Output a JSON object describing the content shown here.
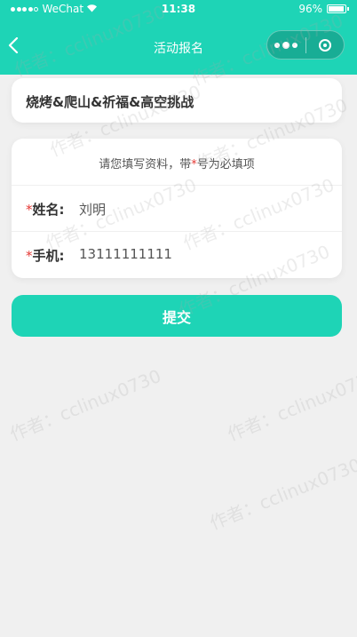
{
  "statusbar": {
    "carrier": "WeChat",
    "time": "11:38",
    "battery": "96%",
    "battery_level": 0.96
  },
  "navbar": {
    "title": "活动报名",
    "back_icon": "chevron-left-icon",
    "more_icon": "more-dots-icon",
    "close_icon": "target-circle-icon"
  },
  "event": {
    "title": "烧烤&爬山&祈福&高空挑战"
  },
  "form": {
    "hint_prefix": "请您填写资料，带",
    "hint_star": "*",
    "hint_suffix": "号为必填项",
    "fields": [
      {
        "required_mark": "*",
        "label": "姓名:",
        "value": "刘明"
      },
      {
        "required_mark": "*",
        "label": "手机:",
        "value": "13111111111"
      }
    ]
  },
  "submit_label": "提交",
  "watermark": "作者：cclinux0730",
  "colors": {
    "accent": "#1ed4b6",
    "required": "#e53935",
    "background": "#f0f0f0"
  }
}
